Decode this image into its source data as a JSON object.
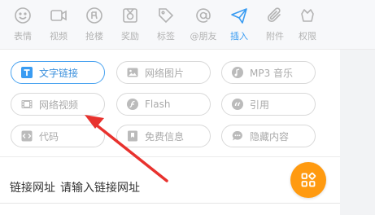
{
  "toolbar": {
    "items": [
      {
        "label": "表情",
        "icon": "smile-icon"
      },
      {
        "label": "视频",
        "icon": "video-camera-icon"
      },
      {
        "label": "抢楼",
        "icon": "grab-floor-icon"
      },
      {
        "label": "奖励",
        "icon": "reward-icon"
      },
      {
        "label": "标签",
        "icon": "tag-icon"
      },
      {
        "label": "@朋友",
        "icon": "at-icon"
      },
      {
        "label": "插入",
        "icon": "send-icon",
        "active": true
      },
      {
        "label": "附件",
        "icon": "paperclip-icon"
      },
      {
        "label": "权限",
        "icon": "permission-icon"
      }
    ]
  },
  "insert_panel": {
    "buttons": [
      {
        "label": "文字链接",
        "icon": "text-t-icon",
        "active": true
      },
      {
        "label": "网络图片",
        "icon": "image-icon"
      },
      {
        "label": "MP3 音乐",
        "icon": "music-icon"
      },
      {
        "label": "网络视频",
        "icon": "film-icon"
      },
      {
        "label": "Flash",
        "icon": "flash-icon"
      },
      {
        "label": "引用",
        "icon": "quote-icon"
      },
      {
        "label": "代码",
        "icon": "code-icon"
      },
      {
        "label": "免费信息",
        "icon": "bookmark-icon"
      },
      {
        "label": "隐藏内容",
        "icon": "chat-bubble-icon"
      }
    ]
  },
  "link_form": {
    "label": "链接网址",
    "placeholder": "请输入链接网址"
  },
  "fab": {
    "icon": "grid-apps-icon"
  },
  "colors": {
    "accent": "#3a9cf2",
    "fab": "#ff9a10",
    "annotation_arrow": "#e8322e",
    "muted": "#b3b3b3"
  }
}
